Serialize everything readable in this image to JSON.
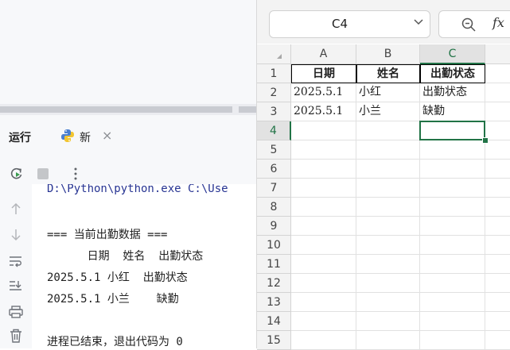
{
  "ide": {
    "run_title": "运行",
    "tab_label": "新",
    "console": {
      "path_line": "D:\\Python\\python.exe C:\\Use",
      "lines": [
        "=== 当前出勤数据 ===",
        "      日期  姓名  出勤状态",
        "2025.5.1 小红  出勤状态",
        "2025.5.1 小兰    缺勤",
        "",
        "进程已结束，退出代码为 0"
      ]
    }
  },
  "sheet": {
    "name_box": "C4",
    "fx_label": "fx",
    "columns": [
      "A",
      "B",
      "C"
    ],
    "selected_column": "C",
    "rows": [
      "1",
      "2",
      "3",
      "4",
      "5",
      "6",
      "7",
      "8",
      "9",
      "10",
      "11",
      "12",
      "13",
      "14",
      "15"
    ],
    "selected_row": "4",
    "cells": {
      "A1": "日期",
      "B1": "姓名",
      "C1": "出勤状态",
      "A2": "2025.5.1",
      "B2": "小红",
      "C2": "出勤状态",
      "A3": "2025.5.1",
      "B3": "小兰",
      "C3": "缺勤"
    }
  },
  "colors": {
    "accent_green": "#217346",
    "accent_blue": "#3574f0"
  }
}
